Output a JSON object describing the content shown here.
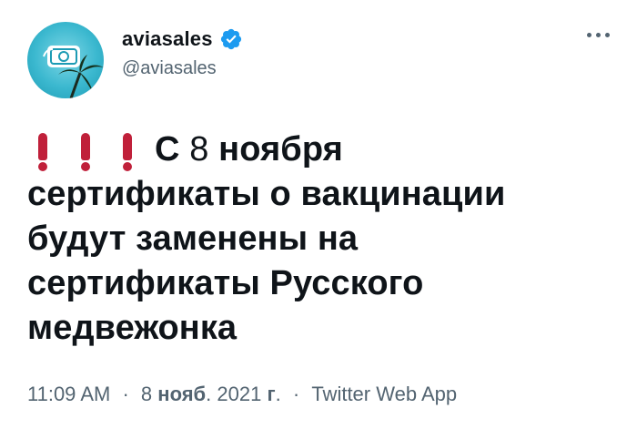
{
  "author": {
    "display_name": "aviasales",
    "handle": "@aviasales",
    "verified": true
  },
  "tweet": {
    "lines": [
      {
        "prefix_emoji": "exclamation-icon x3",
        "text": "С 8 ноября"
      },
      {
        "text": "сертификаты о вакцинации"
      },
      {
        "text": "будут заменены на"
      },
      {
        "text": "сертификаты Русского"
      },
      {
        "text": "медвежонка"
      }
    ],
    "line1_c": "С",
    "line1_num": "8",
    "line1_word": "ноября"
  },
  "meta": {
    "time": "11:09 AM",
    "sep1": "·",
    "date_day": "8",
    "date_month": "нояб",
    "date_year": "2021",
    "date_suffix": "г",
    "sep2": "·",
    "source": "Twitter Web App"
  },
  "colors": {
    "text": "#0f1419",
    "secondary": "#536471",
    "verified": "#1d9bf0",
    "exclamation": "#c0203a"
  },
  "icons": [
    "avatar-logo-icon",
    "verified-badge-icon",
    "more-options-icon",
    "exclamation-icon"
  ]
}
